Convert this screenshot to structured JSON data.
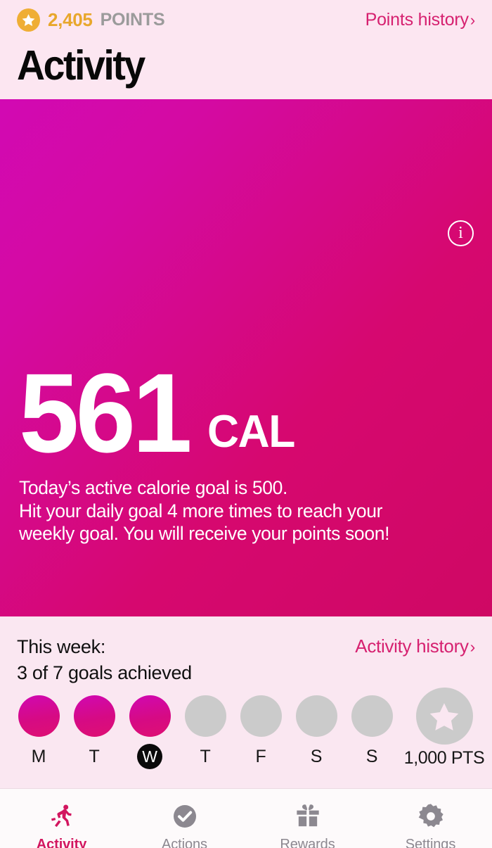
{
  "header": {
    "points_value": "2,405",
    "points_label": "POINTS",
    "points_history_link": "Points history",
    "chevron": "›",
    "title": "Activity",
    "star_icon": "star-icon",
    "points_color": "#E8A72C",
    "link_color": "#D62170"
  },
  "hero": {
    "info_icon": "i",
    "calories": "561",
    "calorie_unit": "CAL",
    "description_line_1": "Today’s active calorie goal is 500.",
    "description_line_2": "Hit your daily goal 4 more times to reach your",
    "description_line_3": "weekly goal. You will receive your points soon!",
    "gradient_start": "#D209B3",
    "gradient_end": "#CF0864"
  },
  "week": {
    "heading": "This week:",
    "subheading": "3 of 7 goals achieved",
    "history_link": "Activity history",
    "chevron": "›",
    "days": [
      {
        "label": "M",
        "achieved": true,
        "today": false
      },
      {
        "label": "T",
        "achieved": true,
        "today": false
      },
      {
        "label": "W",
        "achieved": true,
        "today": true
      },
      {
        "label": "T",
        "achieved": false,
        "today": false
      },
      {
        "label": "F",
        "achieved": false,
        "today": false
      },
      {
        "label": "S",
        "achieved": false,
        "today": false
      },
      {
        "label": "S",
        "achieved": false,
        "today": false
      }
    ],
    "reward": {
      "label": "1,000 PTS",
      "icon": "star-icon",
      "earned": false
    },
    "achieved_color": "#D60A84",
    "inactive_color": "#CBCBCB"
  },
  "tabbar": {
    "tabs": [
      {
        "label": "Activity",
        "icon": "running-person-icon",
        "active": true
      },
      {
        "label": "Actions",
        "icon": "check-circle-icon",
        "active": false
      },
      {
        "label": "Rewards",
        "icon": "gift-icon",
        "active": false
      },
      {
        "label": "Settings",
        "icon": "gear-icon",
        "active": false
      }
    ],
    "active_color": "#D2165F",
    "inactive_color": "#8C8890"
  }
}
